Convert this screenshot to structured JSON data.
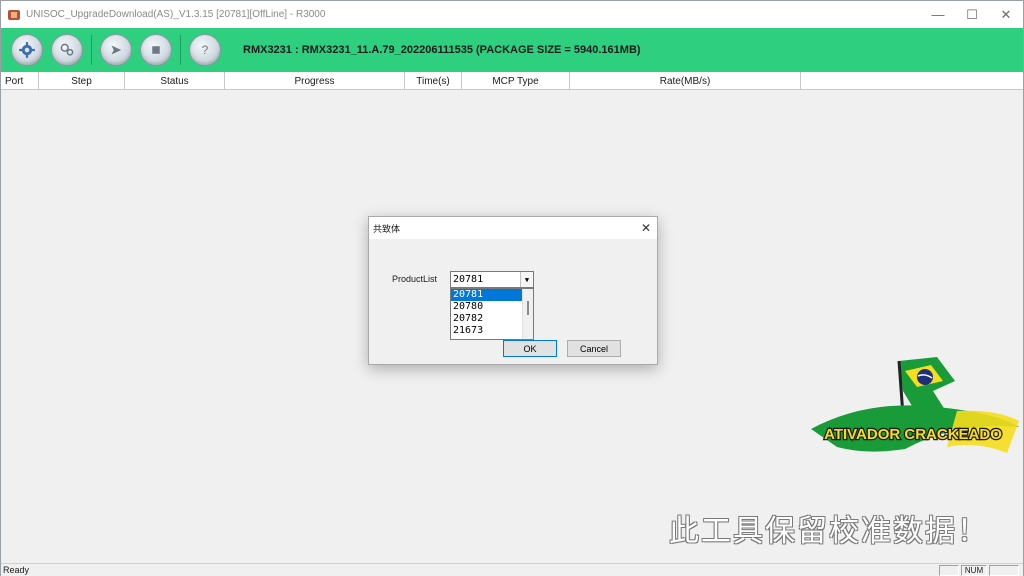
{
  "window": {
    "title": "UNISOC_UpgradeDownload(AS)_V1.3.15 [20781][OffLine] - R3000"
  },
  "window_controls": {
    "minimize": "—",
    "maximize": "☐",
    "close": "✕"
  },
  "toolbar": {
    "buttons": [
      "settings-gear",
      "load-settings",
      "start-download",
      "stop",
      "help"
    ],
    "package_info": "RMX3231 : RMX3231_11.A.79_202206111535 (PACKAGE SIZE = 5940.161MB)"
  },
  "table": {
    "columns": [
      "Port",
      "Step",
      "Status",
      "Progress",
      "Time(s)",
      "MCP Type",
      "Rate(MB/s)"
    ]
  },
  "dialog": {
    "title": "共致体",
    "close": "✕",
    "label": "ProductList",
    "selected_value": "20781",
    "arrow": "▼",
    "options": [
      "20781",
      "20780",
      "20782",
      "21673"
    ],
    "ok_label": "OK",
    "cancel_label": "Cancel"
  },
  "overlay": {
    "watermark_text": "ATIVADOR CRACKEADO",
    "chinese_text": "此工具保留校准数据！"
  },
  "statusbar": {
    "status": "Ready",
    "num": "NUM"
  },
  "colors": {
    "toolbar_green": "#2ecf7f",
    "selection_blue": "#0078d7",
    "brazil_green": "#1a9b3a",
    "brazil_yellow": "#f6dd1e",
    "brazil_blue": "#1e2f7a"
  }
}
